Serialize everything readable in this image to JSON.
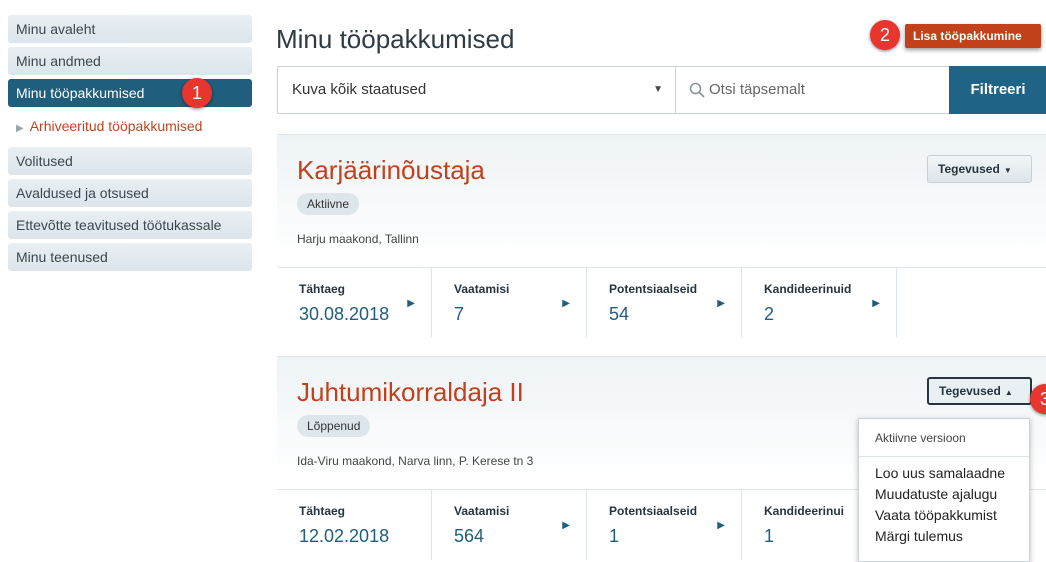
{
  "sidebar": {
    "items": [
      {
        "label": "Minu avaleht"
      },
      {
        "label": "Minu andmed"
      },
      {
        "label": "Minu tööpakkumised"
      },
      {
        "label": "Arhiveeritud tööpakkumised"
      },
      {
        "label": "Volitused"
      },
      {
        "label": "Avaldused ja otsused"
      },
      {
        "label": "Ettevõtte teavitused töötukassale"
      },
      {
        "label": "Minu teenused"
      }
    ]
  },
  "markers": {
    "one": "1",
    "two": "2",
    "three": "3"
  },
  "header": {
    "title": "Minu tööpakkumised",
    "add_button": "Lisa tööpakkumine"
  },
  "filter": {
    "status_value": "Kuva kõik staatused",
    "search_placeholder": "Otsi täpsemalt",
    "filter_button": "Filtreeri"
  },
  "jobs": [
    {
      "title": "Karjäärinõustaja",
      "status": "Aktiivne",
      "location": "Harju maakond, Tallinn",
      "actions_label": "Tegevused",
      "stats": [
        {
          "label": "Tähtaeg",
          "value": "30.08.2018"
        },
        {
          "label": "Vaatamisi",
          "value": "7"
        },
        {
          "label": "Potentsiaalseid",
          "value": "54"
        },
        {
          "label": "Kandideerinuid",
          "value": "2"
        }
      ]
    },
    {
      "title": "Juhtumikorraldaja II",
      "status": "Lõppenud",
      "location": "Ida-Viru maakond, Narva linn, P. Kerese tn 3",
      "actions_label": "Tegevused",
      "stats": [
        {
          "label": "Tähtaeg",
          "value": "12.02.2018"
        },
        {
          "label": "Vaatamisi",
          "value": "564"
        },
        {
          "label": "Potentsiaalseid",
          "value": "1"
        },
        {
          "label": "Kandideerinui",
          "value": "1"
        }
      ]
    }
  ],
  "dropdown": {
    "header": "Aktiivne versioon",
    "items": [
      "Loo uus samalaadne",
      "Muudatuste ajalugu",
      "Vaata tööpakkumist",
      "Märgi tulemus"
    ]
  }
}
